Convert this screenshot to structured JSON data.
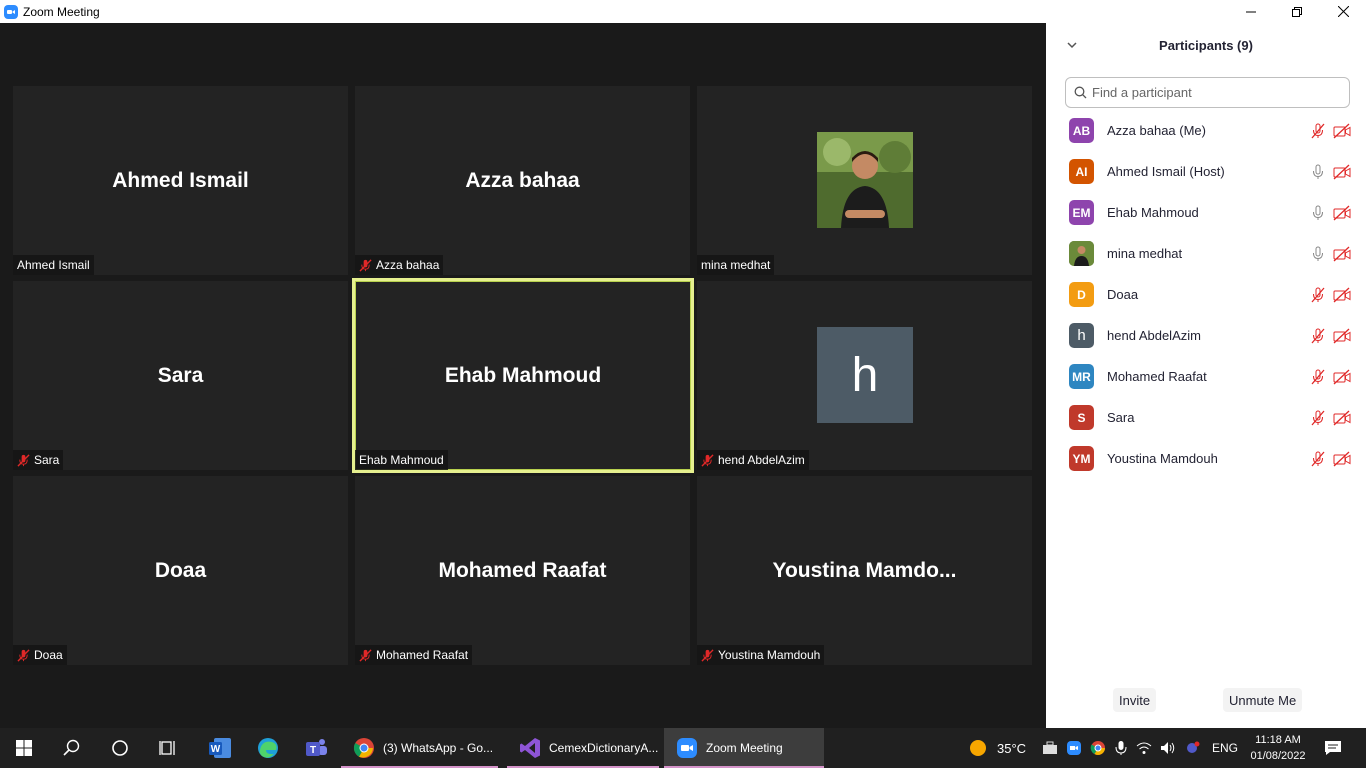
{
  "window": {
    "title": "Zoom Meeting",
    "minimize": "—",
    "restore": "❐",
    "close": "✕"
  },
  "tiles": [
    {
      "center": "Ahmed Ismail",
      "label": "Ahmed Ismail",
      "muted": false
    },
    {
      "center": "Azza bahaa",
      "label": "Azza bahaa",
      "muted": true
    },
    {
      "center": "",
      "label": "mina medhat",
      "muted": false
    },
    {
      "center": "Sara",
      "label": "Sara",
      "muted": true
    },
    {
      "center": "Ehab Mahmoud",
      "label": "Ehab Mahmoud",
      "muted": false,
      "active": true
    },
    {
      "center": "h",
      "label": "hend AbdelAzim",
      "muted": true
    },
    {
      "center": "Doaa",
      "label": "Doaa",
      "muted": true
    },
    {
      "center": "Mohamed Raafat",
      "label": "Mohamed Raafat",
      "muted": true
    },
    {
      "center": "Youstina  Mamdo...",
      "label": "Youstina Mamdouh",
      "muted": true
    }
  ],
  "panel": {
    "title": "Participants (9)",
    "search_placeholder": "Find a participant",
    "participants": [
      {
        "initials": "AB",
        "name": "Azza bahaa (Me)",
        "color": "#8e44ad",
        "mic": "muted"
      },
      {
        "initials": "AI",
        "name": "Ahmed Ismail (Host)",
        "color": "#d35400",
        "mic": "on"
      },
      {
        "initials": "EM",
        "name": "Ehab Mahmoud",
        "color": "#8e44ad",
        "mic": "on"
      },
      {
        "initials": "",
        "name": "mina medhat",
        "color": "#556b2f",
        "mic": "on"
      },
      {
        "initials": "D",
        "name": "Doaa",
        "color": "#f39c12",
        "mic": "muted"
      },
      {
        "initials": "h",
        "name": "hend AbdelAzim",
        "color": "#4d5b66",
        "mic": "muted"
      },
      {
        "initials": "MR",
        "name": "Mohamed Raafat",
        "color": "#2e86c1",
        "mic": "muted"
      },
      {
        "initials": "S",
        "name": "Sara",
        "color": "#c0392b",
        "mic": "muted"
      },
      {
        "initials": "YM",
        "name": "Youstina Mamdouh",
        "color": "#c0392b",
        "mic": "muted"
      }
    ],
    "invite_label": "Invite",
    "unmute_label": "Unmute Me"
  },
  "taskbar": {
    "apps": [
      {
        "label": "(3) WhatsApp - Go..."
      },
      {
        "label": "CemexDictionaryA..."
      },
      {
        "label": "Zoom Meeting"
      }
    ],
    "weather": "35°C",
    "language": "ENG",
    "time": "11:18 AM",
    "date": "01/08/2022"
  },
  "colors": {
    "accent": "#2d8cff",
    "muted_red": "#e02828",
    "active_border": "#e6f08f"
  }
}
